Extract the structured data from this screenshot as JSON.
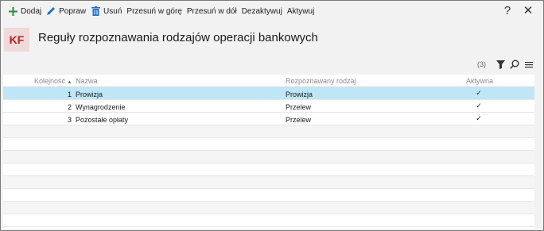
{
  "toolbar": {
    "add_label": "Dodaj",
    "edit_label": "Popraw",
    "delete_label": "Usuń",
    "move_up_label": "Przesuń w górę",
    "move_down_label": "Przesuń w dół",
    "deactivate_label": "Dezaktywuj",
    "activate_label": "Aktywuj",
    "help_symbol": "?",
    "close_symbol": "✕"
  },
  "header": {
    "logo_text": "KF",
    "title": "Reguły rozpoznawania rodzajów operacji bankowych"
  },
  "list_tools": {
    "count": "(3)"
  },
  "table": {
    "columns": {
      "order": "Kolejność",
      "name": "Nazwa",
      "type": "Rozpoznawany rodzaj",
      "active": "Aktywna"
    },
    "sort_indicator": "▲",
    "rows": [
      {
        "order": "1",
        "name": "Prowizja",
        "type": "Prowizja",
        "active": "✓"
      },
      {
        "order": "2",
        "name": "Wynagrodzenie",
        "type": "Przelew",
        "active": "✓"
      },
      {
        "order": "3",
        "name": "Pozostałe opłaty",
        "type": "Przelew",
        "active": "✓"
      }
    ]
  },
  "colors": {
    "accent_green": "#2e8b2e",
    "edit_blue": "#1e6fc9",
    "selection": "#bfe6f7",
    "logo_red": "#b11f1f"
  },
  "icons": {
    "add": "plus-icon",
    "edit": "pencil-icon",
    "delete": "trash-icon",
    "filter": "filter-icon",
    "search": "search-icon",
    "menu": "menu-icon"
  }
}
